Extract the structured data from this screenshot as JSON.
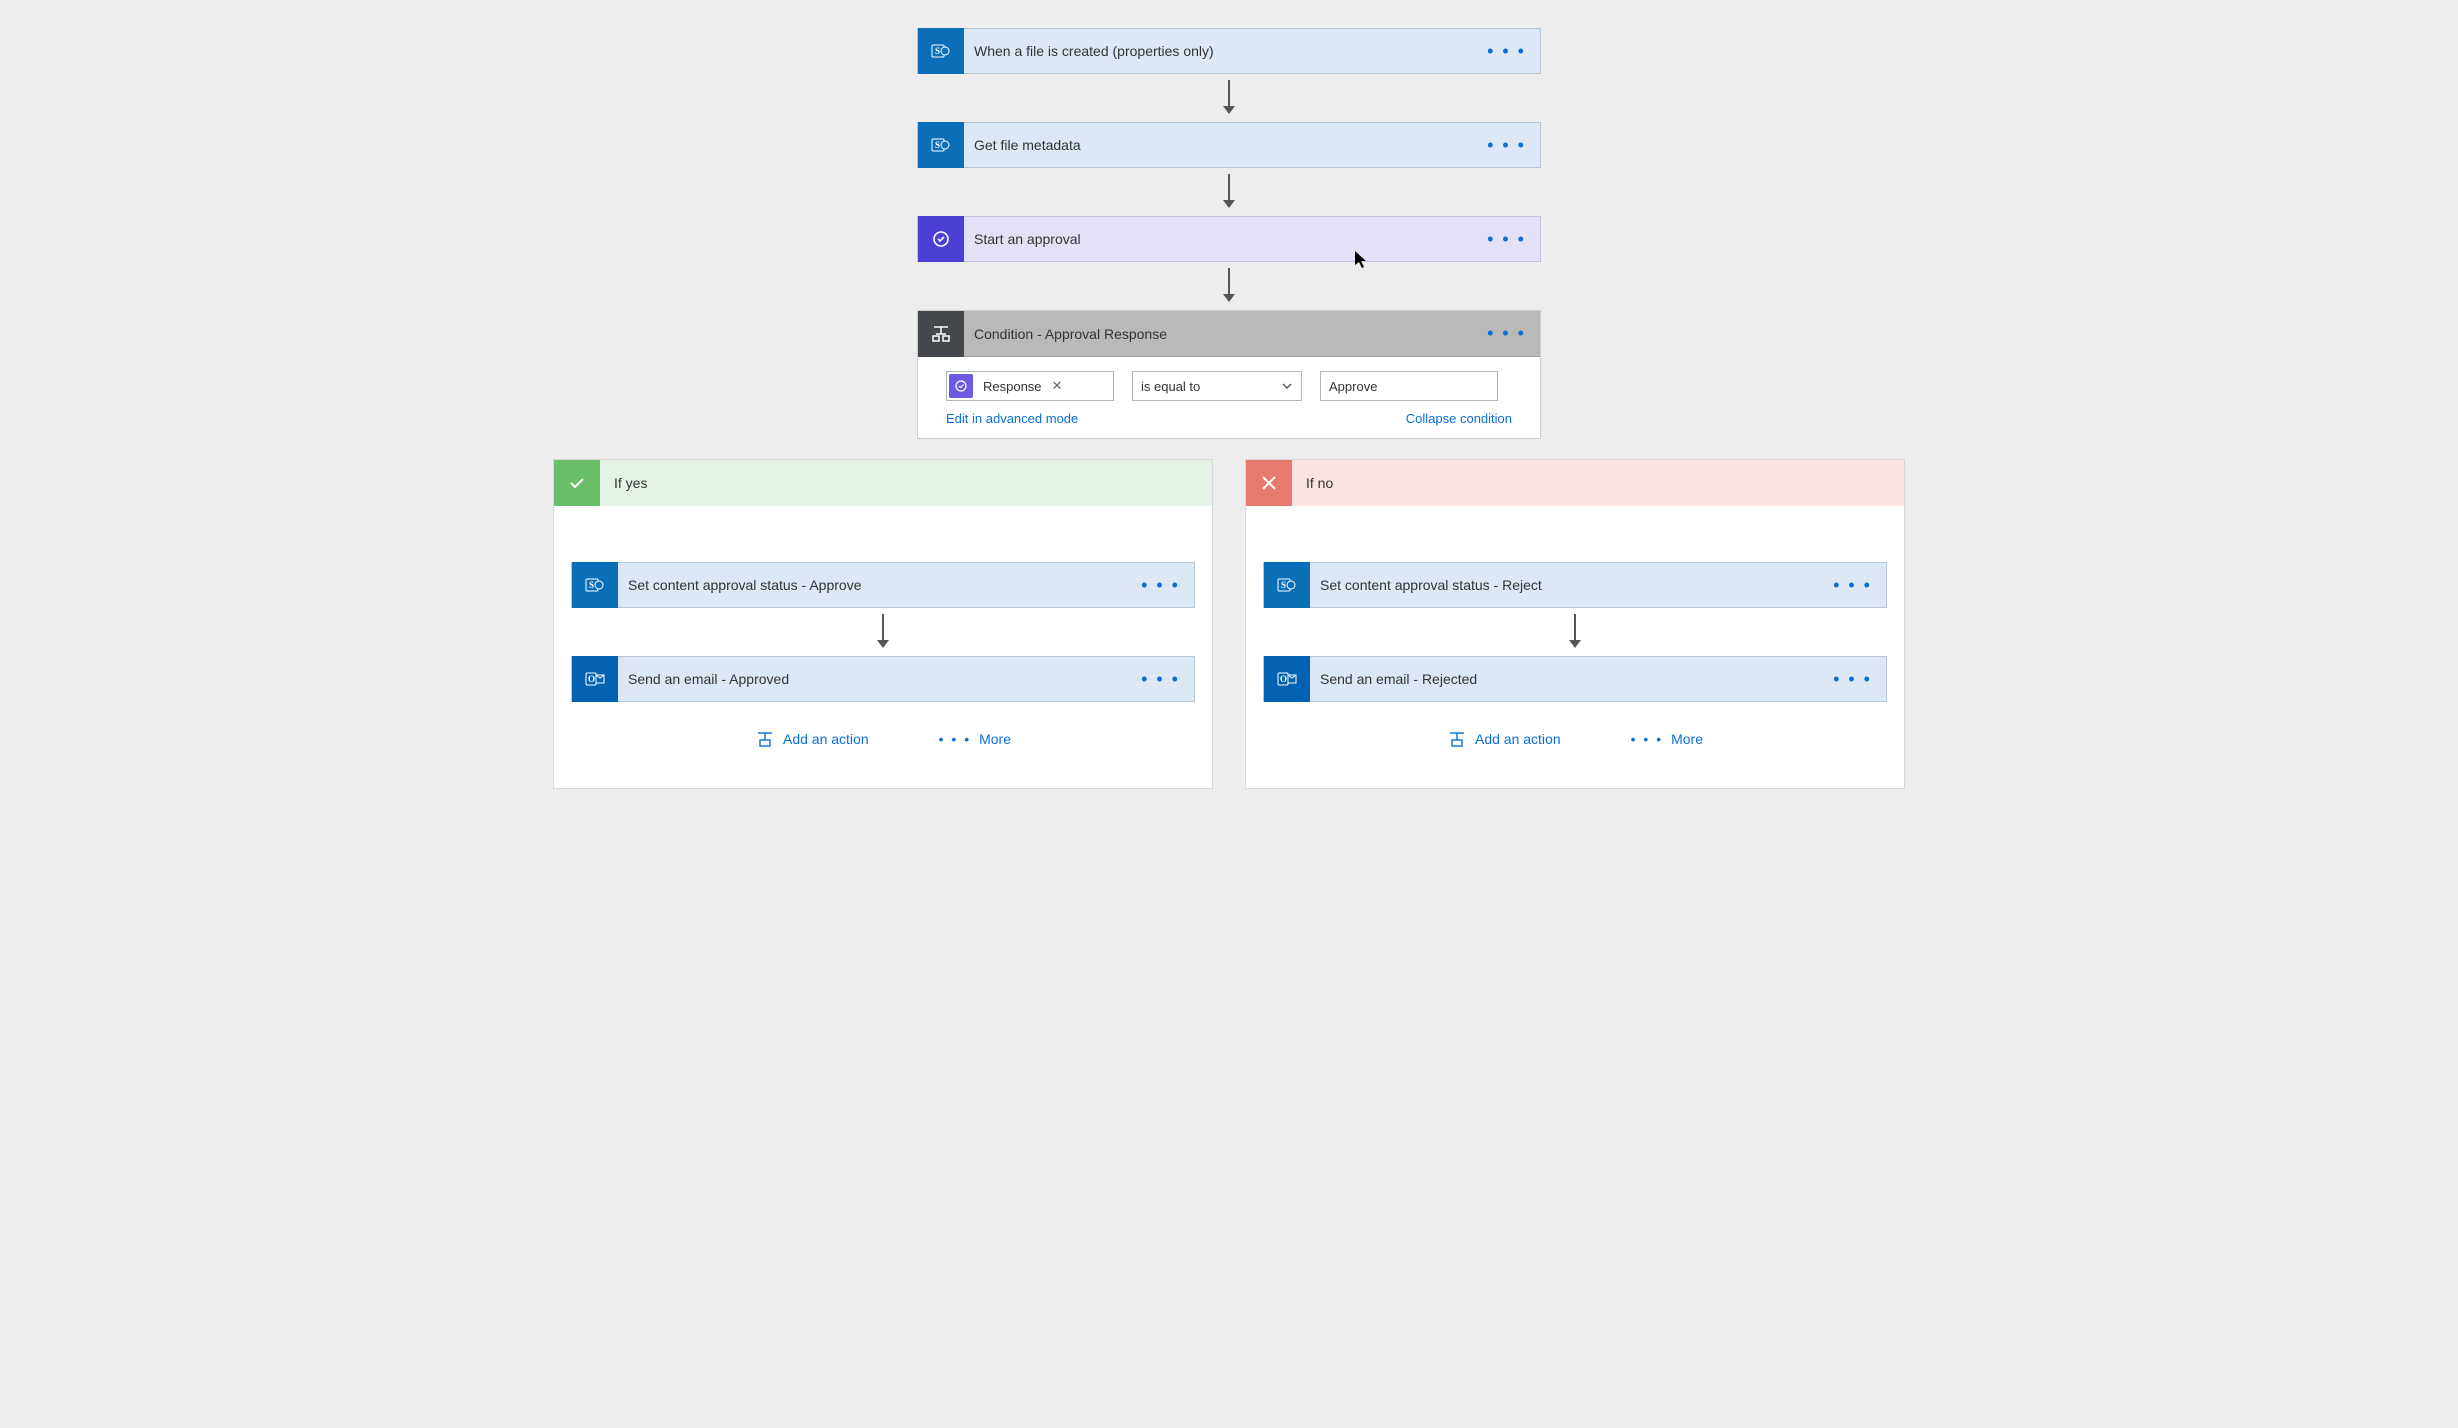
{
  "flow": {
    "steps": [
      {
        "label": "When a file is created (properties only)"
      },
      {
        "label": "Get file metadata"
      },
      {
        "label": "Start an approval"
      }
    ],
    "condition": {
      "label": "Condition - Approval Response",
      "token": "Response",
      "operator": "is equal to",
      "value": "Approve",
      "edit_advanced": "Edit in advanced mode",
      "collapse": "Collapse condition"
    },
    "branches": {
      "yes": {
        "title": "If yes",
        "actions": [
          "Set content approval status - Approve",
          "Send an email - Approved"
        ]
      },
      "no": {
        "title": "If no",
        "actions": [
          "Set content approval status - Reject",
          "Send an email - Rejected"
        ]
      },
      "add_action": "Add an action",
      "more": "More"
    }
  }
}
